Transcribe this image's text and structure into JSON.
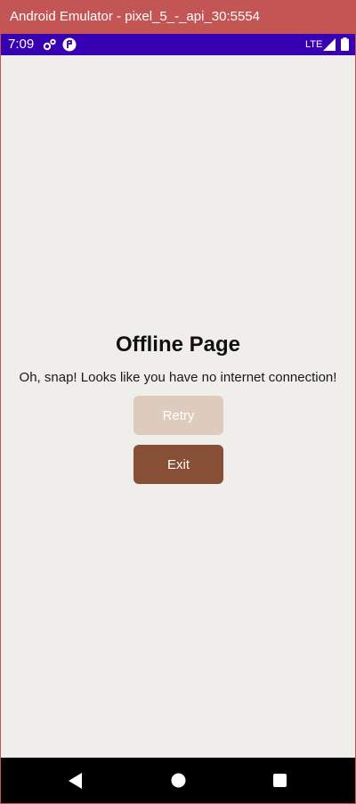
{
  "window": {
    "title": "Android Emulator - pixel_5_-_api_30:5554"
  },
  "status_bar": {
    "time": "7:09",
    "network": "LTE",
    "icons": [
      "gear-icon",
      "app-circle-icon",
      "signal-icon",
      "battery-icon"
    ]
  },
  "page": {
    "title": "Offline Page",
    "message": "Oh, snap! Looks like you have no internet connection!",
    "retry_label": "Retry",
    "exit_label": "Exit"
  },
  "nav_bar": {
    "icons": [
      "back-icon",
      "home-icon",
      "recents-icon"
    ]
  },
  "colors": {
    "title_bar": "#c45555",
    "status_bar": "#3700b3",
    "background": "#efeeea",
    "retry_button": "#ddccbd",
    "exit_button": "#874f35",
    "nav_bar": "#000000"
  }
}
